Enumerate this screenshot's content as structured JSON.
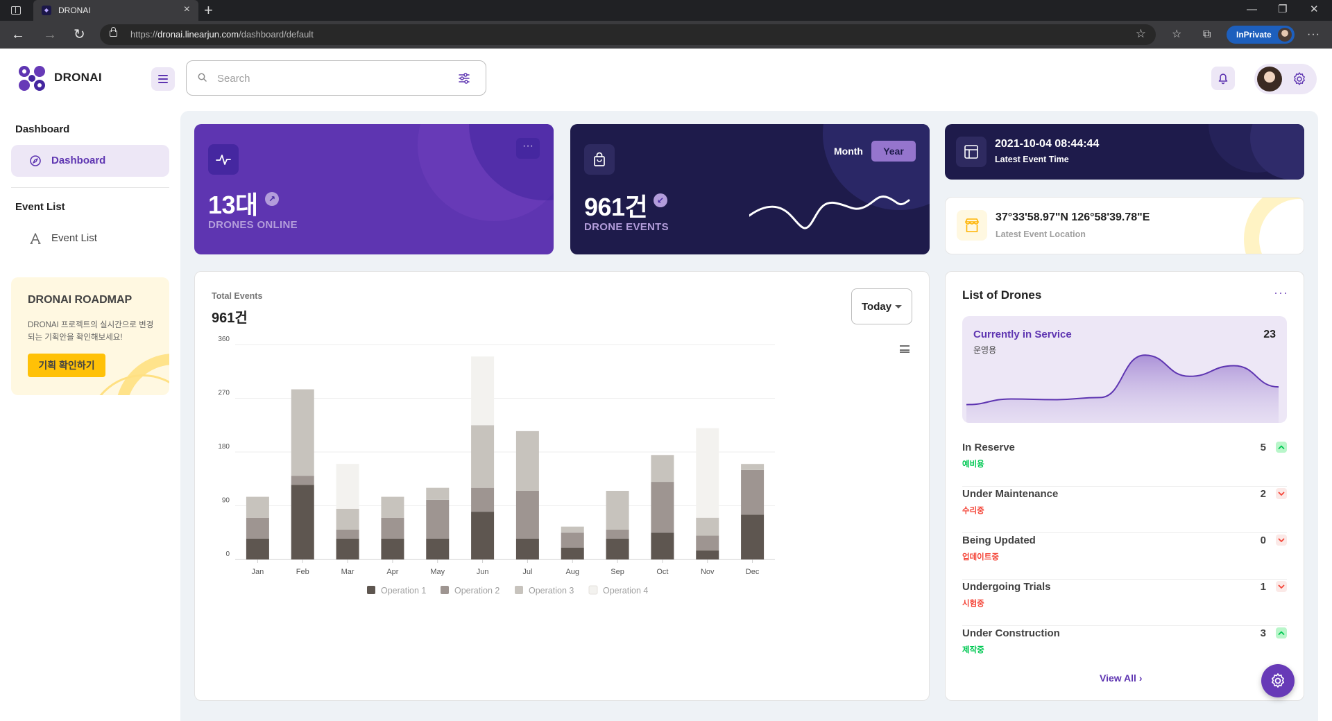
{
  "browser": {
    "tab_title": "DRONAI",
    "url_prefix": "https://",
    "url_host": "dronai.linearjun.com",
    "url_path": "/dashboard/default",
    "inprivate_label": "InPrivate"
  },
  "header": {
    "brand": "DRONAI",
    "search_placeholder": "Search"
  },
  "sidebar": {
    "sections": [
      {
        "title": "Dashboard",
        "item": "Dashboard",
        "active": true
      },
      {
        "title": "Event List",
        "item": "Event List",
        "active": false
      }
    ],
    "roadmap": {
      "title": "DRONAI ROADMAP",
      "description": "DRONAI 프로젝트의 실시간으로 변경되는 기획안을 확인해보세요!",
      "button": "기획 확인하기"
    }
  },
  "cards": {
    "drones": {
      "value": "13대",
      "label": "DRONES ONLINE"
    },
    "events": {
      "value": "961건",
      "label": "DRONE EVENTS",
      "toggle": [
        "Month",
        "Year"
      ],
      "active_toggle": "Year"
    },
    "latest_time": {
      "value": "2021-10-04 08:44:44",
      "label": "Latest Event Time"
    },
    "latest_location": {
      "value": "37°33'58.97\"N 126°58'39.78\"E",
      "label": "Latest Event Location"
    }
  },
  "total_events": {
    "caption": "Total Events",
    "value": "961건",
    "filter": "Today"
  },
  "chart_data": {
    "type": "bar",
    "stacked": true,
    "categories": [
      "Jan",
      "Feb",
      "Mar",
      "Apr",
      "May",
      "Jun",
      "Jul",
      "Aug",
      "Sep",
      "Oct",
      "Nov",
      "Dec"
    ],
    "yticks": [
      0,
      90,
      180,
      270,
      360
    ],
    "ylim": [
      0,
      360
    ],
    "grid": true,
    "legend_position": "bottom",
    "series": [
      {
        "name": "Operation 1",
        "color": "#5e5650",
        "values": [
          35,
          125,
          35,
          35,
          35,
          80,
          35,
          20,
          35,
          45,
          15,
          75
        ]
      },
      {
        "name": "Operation 2",
        "color": "#9e9591",
        "values": [
          35,
          15,
          15,
          35,
          65,
          40,
          80,
          25,
          15,
          85,
          25,
          75
        ]
      },
      {
        "name": "Operation 3",
        "color": "#c7c3bd",
        "values": [
          35,
          145,
          35,
          35,
          20,
          105,
          100,
          10,
          65,
          45,
          30,
          10
        ]
      },
      {
        "name": "Operation 4",
        "color": "#f3f2ef",
        "values": [
          0,
          0,
          75,
          0,
          0,
          115,
          0,
          0,
          0,
          0,
          150,
          0
        ]
      }
    ]
  },
  "drone_list": {
    "title": "List of Drones",
    "service": {
      "label": "Currently in Service",
      "sub": "운영용",
      "value": "23",
      "trend": [
        20,
        28,
        27,
        30,
        90,
        60,
        75,
        45
      ]
    },
    "rows": [
      {
        "name": "In Reserve",
        "sub": "예비용",
        "value": "5",
        "trend": "up"
      },
      {
        "name": "Under Maintenance",
        "sub": "수리중",
        "value": "2",
        "trend": "down"
      },
      {
        "name": "Being Updated",
        "sub": "업데이트중",
        "value": "0",
        "trend": "down"
      },
      {
        "name": "Undergoing Trials",
        "sub": "시험중",
        "value": "1",
        "trend": "down"
      },
      {
        "name": "Under Construction",
        "sub": "제작중",
        "value": "3",
        "trend": "up"
      }
    ],
    "view_all": "View All"
  },
  "colors": {
    "primary": "#5e35b1",
    "dark": "#1e1b4b",
    "up": "#00c853",
    "down": "#f44336",
    "warning": "#ffc107"
  }
}
